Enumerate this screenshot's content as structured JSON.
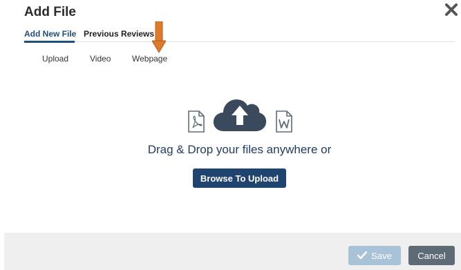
{
  "dialog": {
    "title": "Add File",
    "close_icon": "close-icon"
  },
  "tabs": [
    {
      "label": "Add New File",
      "active": true
    },
    {
      "label": "Previous Reviews",
      "active": false
    }
  ],
  "subtabs": [
    {
      "label": "Upload"
    },
    {
      "label": "Video"
    },
    {
      "label": "Webpage"
    }
  ],
  "dropzone": {
    "text": "Drag & Drop your files anywhere or",
    "browse_label": "Browse To Upload",
    "icons": [
      "pdf-file-icon",
      "upload-cloud-icon",
      "word-file-icon"
    ]
  },
  "footer": {
    "save_label": "Save",
    "cancel_label": "Cancel"
  },
  "colors": {
    "accent": "#1f4e79",
    "button_primary": "#1f4470",
    "save_disabled": "#a8c3d8",
    "cancel": "#5e6b77",
    "arrow": "#e07a2b",
    "cloud": "#3a4a5c"
  }
}
